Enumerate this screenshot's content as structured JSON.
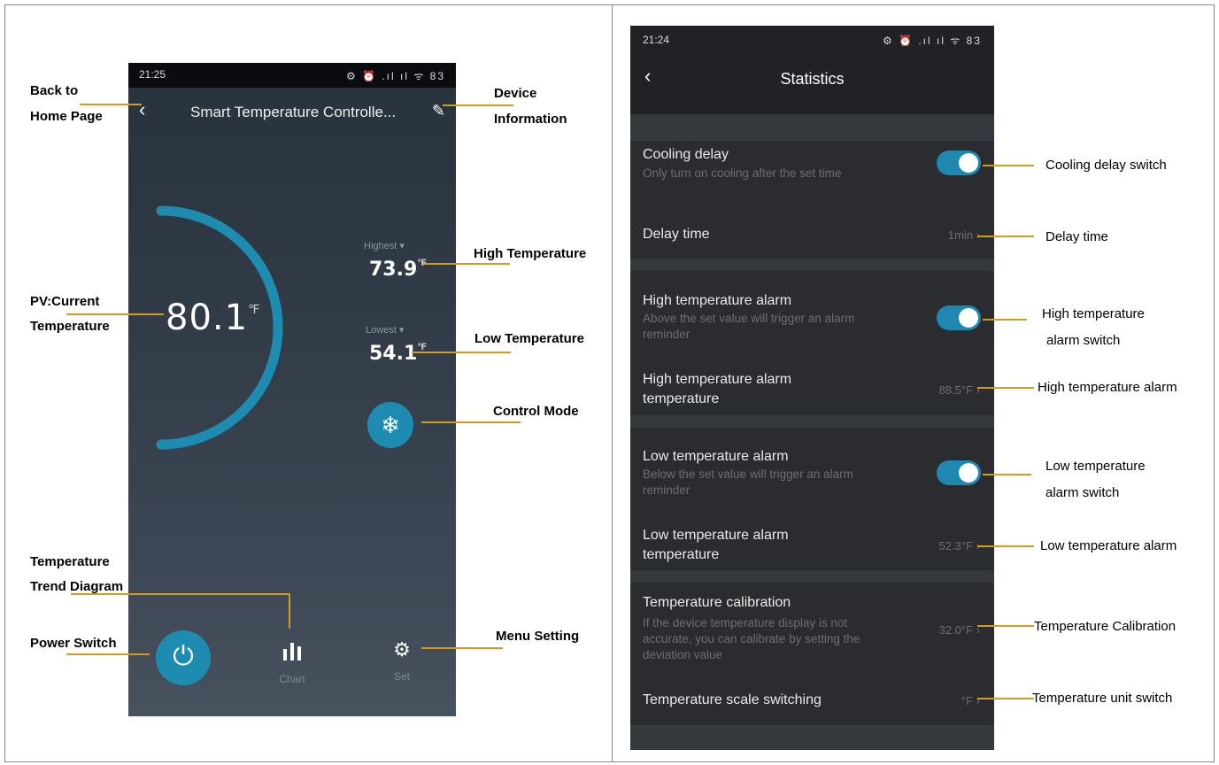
{
  "left": {
    "status": {
      "time": "21:25",
      "icons": "⚙ ⏰ .ıl ıl ᯤ 83"
    },
    "header": {
      "back": "‹",
      "title": "Smart Temperature Controlle...",
      "edit": "✎"
    },
    "pv": {
      "value": "80.1",
      "unit": "℉"
    },
    "highest": {
      "label": "Highest ▾",
      "value": "73.9",
      "unit": "℉"
    },
    "lowest": {
      "label": "Lowest ▾",
      "value": "54.1",
      "unit": "℉"
    },
    "mode_icon": "❄",
    "power_icon": "⏻",
    "chart": {
      "icon": "▮▮▮",
      "label": "Chart"
    },
    "set": {
      "icon": "⚙",
      "label": "Set"
    }
  },
  "right": {
    "status": {
      "time": "21:24",
      "icons": "⚙ ⏰ .ıl ıl ᯤ 83"
    },
    "header": {
      "back": "‹",
      "title": "Statistics"
    },
    "rows": {
      "cooling_delay": {
        "title": "Cooling delay",
        "sub": "Only turn on cooling after the set time",
        "toggle": true
      },
      "delay_time": {
        "title": "Delay time",
        "value": "1min ›"
      },
      "high_alarm": {
        "title": "High temperature alarm",
        "sub1": "Above the set value will trigger an alarm",
        "sub2": "reminder",
        "toggle": true
      },
      "high_alarm_temp": {
        "title1": "High temperature alarm",
        "title2": "temperature",
        "value": "88.5°F ›"
      },
      "low_alarm": {
        "title": "Low temperature alarm",
        "sub1": "Below the set value will trigger an alarm",
        "sub2": "reminder",
        "toggle": true
      },
      "low_alarm_temp": {
        "title1": "Low temperature alarm",
        "title2": "temperature",
        "value": "52.3°F ›"
      },
      "calibration": {
        "title": "Temperature calibration",
        "sub1": "If the device temperature display is not",
        "sub2": "accurate, you can calibrate by setting the",
        "sub3": "deviation value",
        "value": "32.0°F ›"
      },
      "scale": {
        "title": "Temperature scale switching",
        "value": "°F ›"
      }
    }
  },
  "annotations": {
    "back_home_1": "Back to",
    "back_home_2": "Home Page",
    "device_info_1": "Device",
    "device_info_2": "Information",
    "high_temp": "High Temperature",
    "pv_1": "PV:Current",
    "pv_2": "Temperature",
    "low_temp": "Low Temperature",
    "control_mode": "Control Mode",
    "trend_1": "Temperature",
    "trend_2": "Trend Diagram",
    "power_switch": "Power Switch",
    "menu_setting": "Menu Setting",
    "cooling_delay_switch": "Cooling delay switch",
    "delay_time": "Delay time",
    "high_alarm_switch_1": "High temperature",
    "high_alarm_switch_2": "alarm switch",
    "high_alarm": "High temperature alarm",
    "low_alarm_switch_1": "Low temperature",
    "low_alarm_switch_2": "alarm switch",
    "low_alarm": "Low temperature alarm",
    "calibration": "Temperature Calibration",
    "unit_switch": "Temperature unit switch"
  },
  "colors": {
    "accent": "#1e8cb0",
    "callout_line": "#d49a22"
  }
}
